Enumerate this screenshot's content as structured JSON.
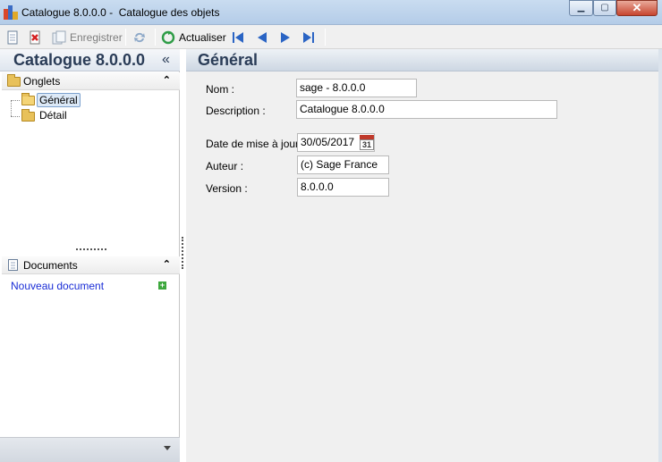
{
  "window": {
    "title": "Catalogue 8.0.0.0 -  Catalogue des objets",
    "min_symbol": "▁",
    "max_symbol": "▢",
    "close_symbol": "✕"
  },
  "toolbar": {
    "save_label": "Enregistrer",
    "refresh_label": "Actualiser",
    "icons": [
      "new-document-icon",
      "delete-icon",
      "save-icon",
      "sync-icon",
      "refresh-icon",
      "first-record-icon",
      "previous-record-icon",
      "next-record-icon",
      "last-record-icon"
    ]
  },
  "left_panel": {
    "title": "Catalogue 8.0.0.0",
    "collapse_symbol": "«",
    "tabs_section": {
      "label": "Onglets",
      "collapse_symbol": "⌃",
      "items": [
        {
          "label": "Général"
        },
        {
          "label": "Détail"
        }
      ]
    },
    "documents_section": {
      "label": "Documents",
      "collapse_symbol": "⌃",
      "new_document_label": "Nouveau document",
      "add_symbol": "+"
    }
  },
  "main": {
    "title": "Général",
    "fields": {
      "name_label": "Nom :",
      "name_value": "sage - 8.0.0.0",
      "description_label": "Description :",
      "description_value": "Catalogue 8.0.0.0",
      "date_label": "Date de mise à jour :",
      "date_value": "30/05/2017",
      "calendar_day": "31",
      "author_label": "Auteur :",
      "author_value": "(c) Sage France",
      "version_label": "Version :",
      "version_value": "8.0.0.0"
    }
  }
}
